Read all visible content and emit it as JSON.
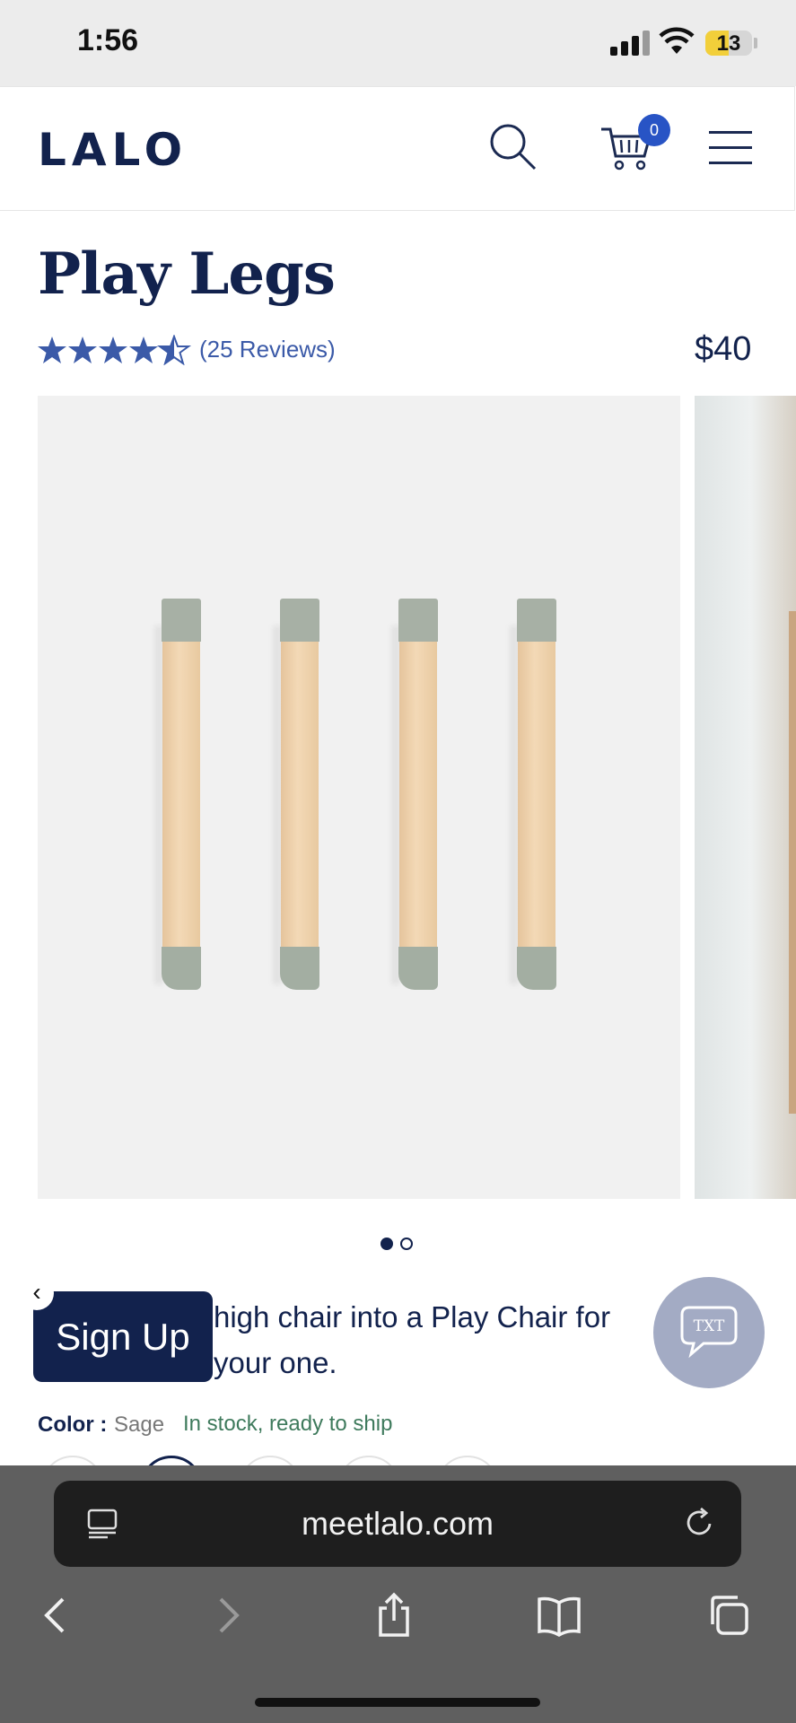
{
  "status_bar": {
    "time": "1:56",
    "battery": "13"
  },
  "header": {
    "logo": "LALO",
    "cart_count": "0"
  },
  "product": {
    "title": "Play Legs",
    "rating": 4.5,
    "reviews_text": "(25 Reviews)",
    "price": "$40"
  },
  "gallery": {
    "slide_count": 2,
    "active_slide": 1
  },
  "description": {
    "text": "high chair into a Play Chair for your one.",
    "signup_label": "Sign Up",
    "txt_label": "TXT"
  },
  "variant": {
    "color_label": "Color :",
    "color_value": "Sage",
    "stock_text": "In stock, ready to ship"
  },
  "browser": {
    "url": "meetlalo.com"
  },
  "colors": {
    "brand_navy": "#12224d",
    "cart_badge_blue": "#2854c5",
    "star_blue": "#3b5aa8",
    "stock_green": "#3e7a5c"
  }
}
